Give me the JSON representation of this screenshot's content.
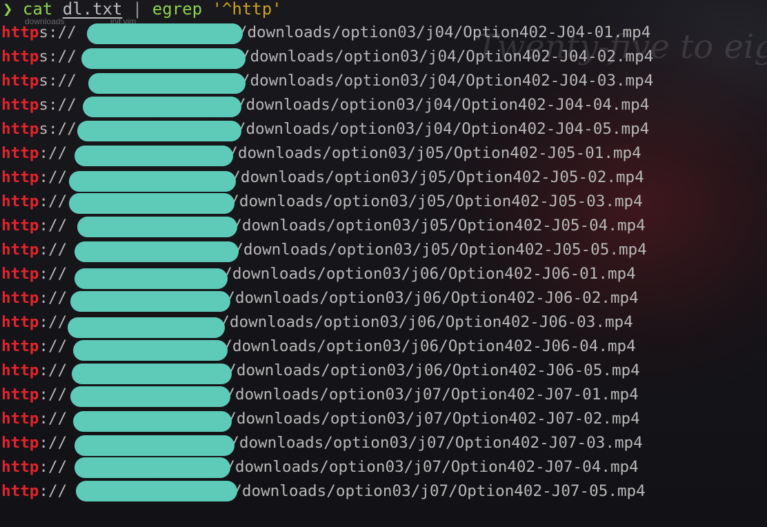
{
  "prompt": {
    "symbol": "❯",
    "command": "cat",
    "file": "dl.txt",
    "pipe": "|",
    "filter": "egrep",
    "pattern": "'^http'",
    "ghost_left": "downloads",
    "ghost_right": "init.vim"
  },
  "background_text": "Twenty-five to eig",
  "colors": {
    "match": "#e3232d",
    "text": "#b8b8b8",
    "redaction": "#5ecbb9",
    "prompt_arrow": "#8fd14f",
    "pattern": "#c9a227"
  },
  "lines": [
    {
      "match": "http",
      "scheme_rest": "s://",
      "hidden_host": "",
      "path": "/downloads/option03/j04/Option402-J04-01.mp4"
    },
    {
      "match": "http",
      "scheme_rest": "s://",
      "hidden_host": "",
      "path": "/downloads/option03/j04/Option402-J04-02.mp4"
    },
    {
      "match": "http",
      "scheme_rest": "s://",
      "hidden_host": "",
      "path": "/downloads/option03/j04/Option402-J04-03.mp4"
    },
    {
      "match": "http",
      "scheme_rest": "s://",
      "hidden_host": "",
      "path": "/downloads/option03/j04/Option402-J04-04.mp4"
    },
    {
      "match": "http",
      "scheme_rest": "s://",
      "hidden_host": "",
      "path": "/downloads/option03/j04/Option402-J04-05.mp4"
    },
    {
      "match": "http",
      "scheme_rest": "://",
      "hidden_host": "",
      "path": "/downloads/option03/j05/Option402-J05-01.mp4"
    },
    {
      "match": "http",
      "scheme_rest": "://",
      "hidden_host": "",
      "path": "/downloads/option03/j05/Option402-J05-02.mp4"
    },
    {
      "match": "http",
      "scheme_rest": "://",
      "hidden_host": "",
      "path": "/downloads/option03/j05/Option402-J05-03.mp4"
    },
    {
      "match": "http",
      "scheme_rest": "://",
      "hidden_host": "",
      "path": "/downloads/option03/j05/Option402-J05-04.mp4"
    },
    {
      "match": "http",
      "scheme_rest": "://",
      "hidden_host": "",
      "path": "/downloads/option03/j05/Option402-J05-05.mp4"
    },
    {
      "match": "http",
      "scheme_rest": "://",
      "hidden_host": "",
      "path": "/downloads/option03/j06/Option402-J06-01.mp4"
    },
    {
      "match": "http",
      "scheme_rest": "://",
      "hidden_host": "",
      "path": "/downloads/option03/j06/Option402-J06-02.mp4"
    },
    {
      "match": "http",
      "scheme_rest": "://",
      "hidden_host": "",
      "path": "/downloads/option03/j06/Option402-J06-03.mp4"
    },
    {
      "match": "http",
      "scheme_rest": "://",
      "hidden_host": "",
      "path": "/downloads/option03/j06/Option402-J06-04.mp4"
    },
    {
      "match": "http",
      "scheme_rest": "://",
      "hidden_host": "",
      "path": "/downloads/option03/j06/Option402-J06-05.mp4"
    },
    {
      "match": "http",
      "scheme_rest": "://",
      "hidden_host": "",
      "path": "/downloads/option03/j07/Option402-J07-01.mp4"
    },
    {
      "match": "http",
      "scheme_rest": "://",
      "hidden_host": "",
      "path": "/downloads/option03/j07/Option402-J07-02.mp4"
    },
    {
      "match": "http",
      "scheme_rest": "://",
      "hidden_host": "",
      "path": "/downloads/option03/j07/Option402-J07-03.mp4"
    },
    {
      "match": "http",
      "scheme_rest": "://",
      "hidden_host": "",
      "path": "/downloads/option03/j07/Option402-J07-04.mp4"
    },
    {
      "match": "http",
      "scheme_rest": "://",
      "hidden_host": "",
      "path": "/downloads/option03/j07/Option402-J07-05.mp4"
    }
  ]
}
